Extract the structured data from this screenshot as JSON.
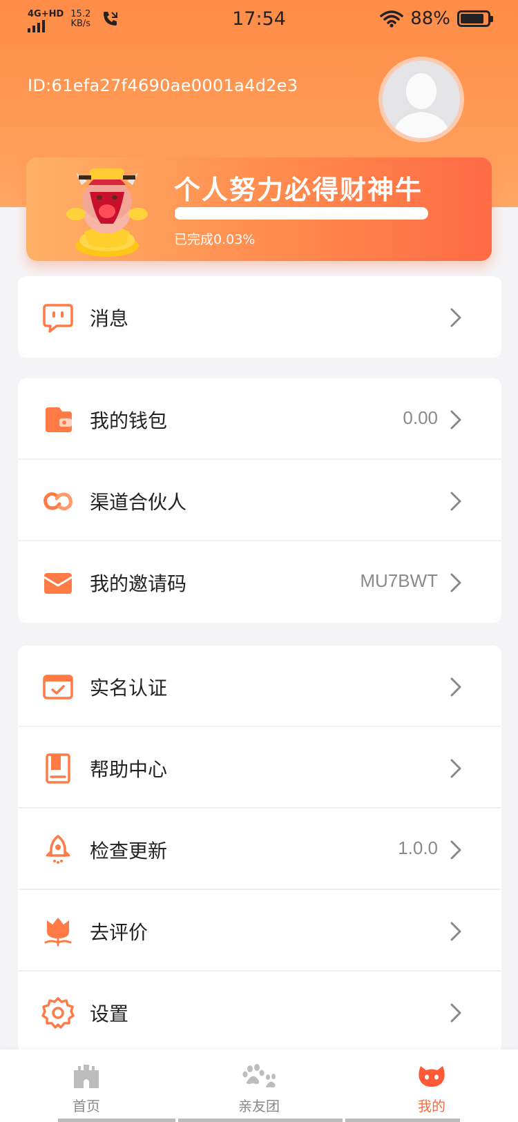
{
  "status_bar": {
    "network": "4G+HD",
    "speed_value": "15.2",
    "speed_unit": "KB/s",
    "time": "17:54",
    "battery": "88%",
    "battery_level": 0.88
  },
  "profile": {
    "id_text": "ID:61efa27f4690ae0001a4d2e3"
  },
  "banner": {
    "title": "个人努力必得财神牛",
    "progress_text": "已完成0.03%",
    "progress": 0.0003
  },
  "menu": {
    "messages": {
      "label": "消息"
    },
    "wallet": {
      "label": "我的钱包",
      "value": "0.00"
    },
    "partner": {
      "label": "渠道合伙人"
    },
    "invite": {
      "label": "我的邀请码",
      "value": "MU7BWT"
    },
    "verify": {
      "label": "实名认证"
    },
    "help": {
      "label": "帮助中心"
    },
    "update": {
      "label": "检查更新",
      "value": "1.0.0"
    },
    "review": {
      "label": "去评价"
    },
    "settings": {
      "label": "设置"
    }
  },
  "tabs": [
    {
      "label": "首页",
      "icon": "castle-icon"
    },
    {
      "label": "亲友团",
      "icon": "paw-icon"
    },
    {
      "label": "我的",
      "icon": "cat-face-icon"
    }
  ],
  "colors": {
    "accent": "#ff6a3d",
    "header_gradient_top": "#ff8c47",
    "icon_orange": "#ff7a45"
  }
}
